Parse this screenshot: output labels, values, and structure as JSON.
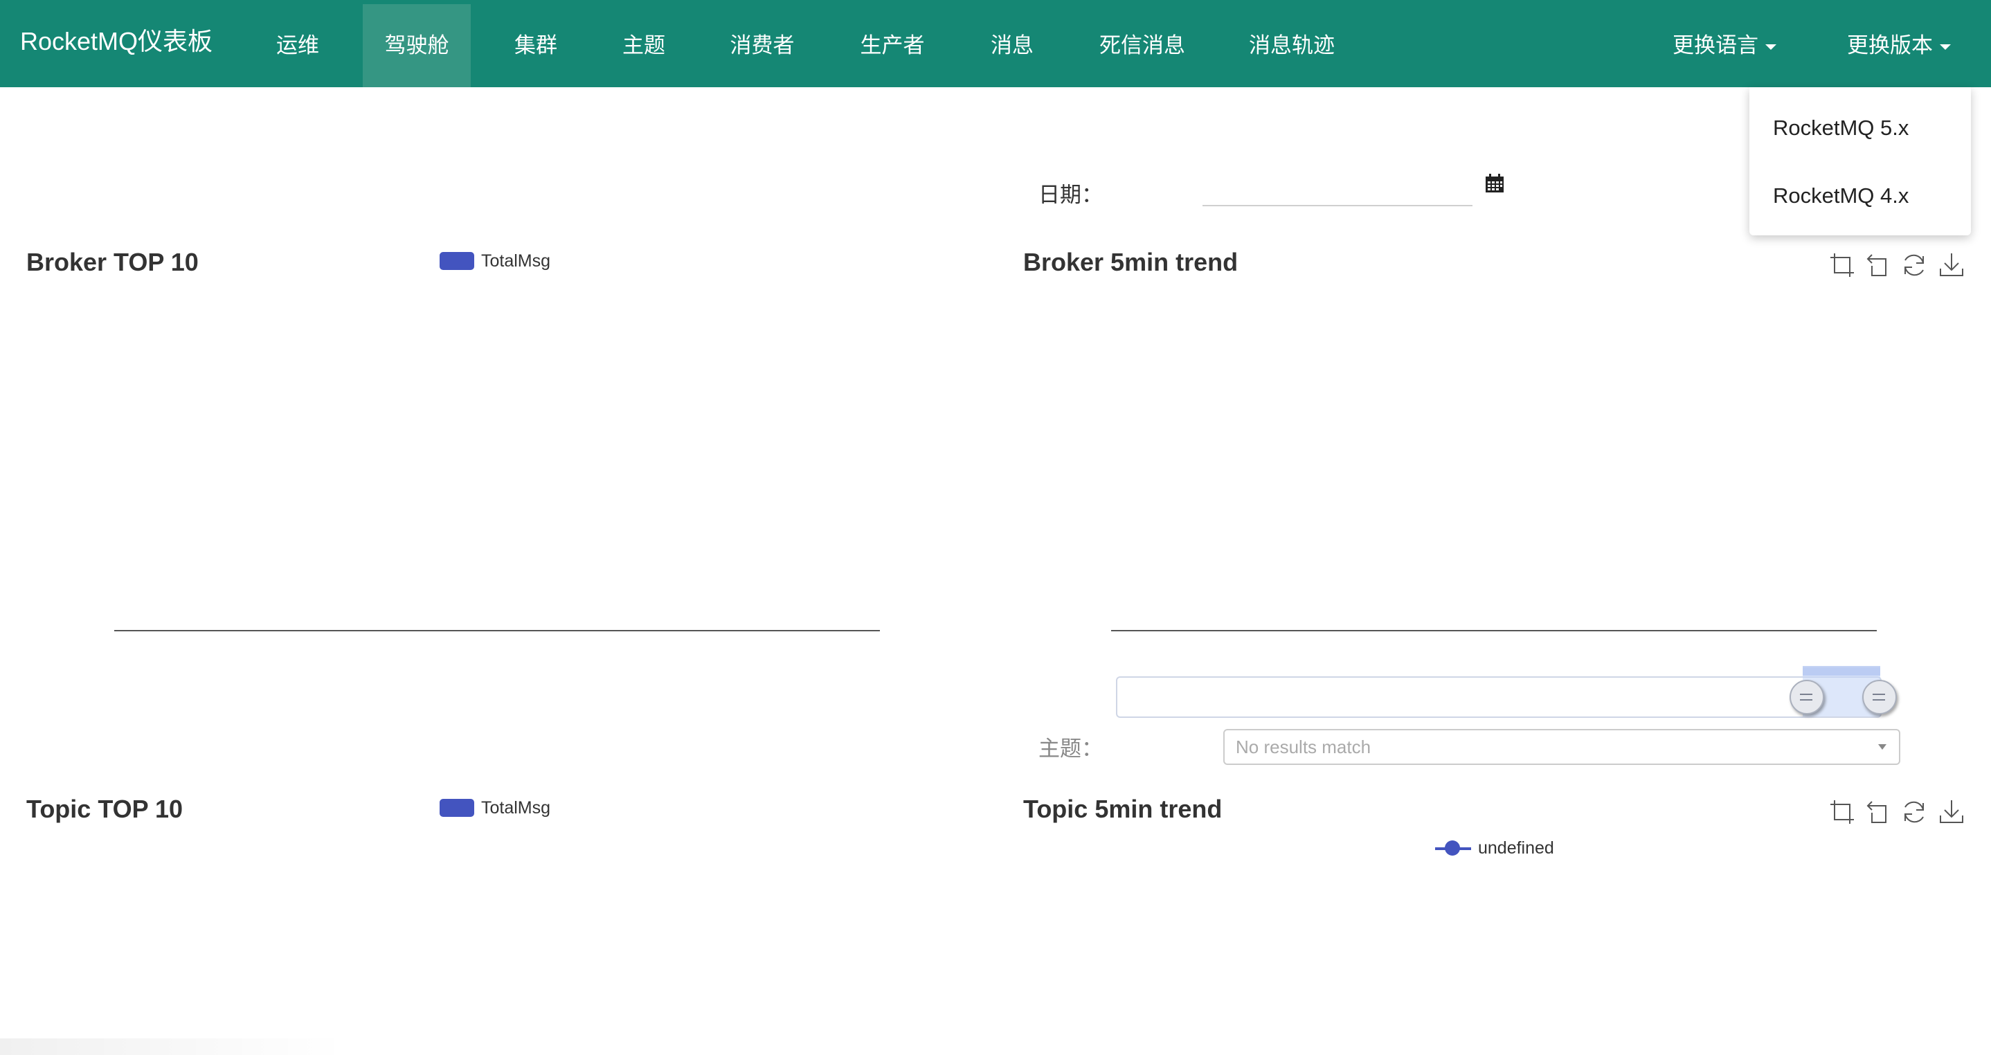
{
  "navbar": {
    "brand": "RocketMQ仪表板",
    "items": [
      {
        "label": "运维"
      },
      {
        "label": "驾驶舱"
      },
      {
        "label": "集群"
      },
      {
        "label": "主题"
      },
      {
        "label": "消费者"
      },
      {
        "label": "生产者"
      },
      {
        "label": "消息"
      },
      {
        "label": "死信消息"
      },
      {
        "label": "消息轨迹"
      }
    ],
    "active_item": "驾驶舱",
    "language_menu": "更换语言",
    "version_menu": "更换版本"
  },
  "version_dropdown": {
    "options": [
      "RocketMQ 5.x",
      "RocketMQ 4.x"
    ]
  },
  "filters": {
    "date_label": "日期：",
    "date_value": "",
    "topic_label": "主题：",
    "topic_placeholder": "No results match"
  },
  "panels": {
    "broker_top10": {
      "title": "Broker TOP 10",
      "legend": "TotalMsg"
    },
    "broker_trend": {
      "title": "Broker 5min trend"
    },
    "topic_top10": {
      "title": "Topic TOP 10",
      "legend": "TotalMsg"
    },
    "topic_trend": {
      "title": "Topic 5min trend",
      "legend": "undefined"
    }
  },
  "colors": {
    "navbar": "#158774",
    "navbar_active": "#359683",
    "series": "#4354bf"
  },
  "toolbox_icons": [
    "zoom-select-icon",
    "zoom-reset-icon",
    "refresh-icon",
    "download-icon"
  ],
  "chart_data": [
    {
      "type": "bar",
      "title": "Broker TOP 10",
      "series": [
        {
          "name": "TotalMsg",
          "values": []
        }
      ],
      "categories": []
    },
    {
      "type": "line",
      "title": "Broker 5min trend",
      "series": [],
      "x": []
    },
    {
      "type": "bar",
      "title": "Topic TOP 10",
      "series": [
        {
          "name": "TotalMsg",
          "values": []
        }
      ],
      "categories": []
    },
    {
      "type": "line",
      "title": "Topic 5min trend",
      "series": [
        {
          "name": "undefined",
          "values": []
        }
      ],
      "x": []
    }
  ]
}
